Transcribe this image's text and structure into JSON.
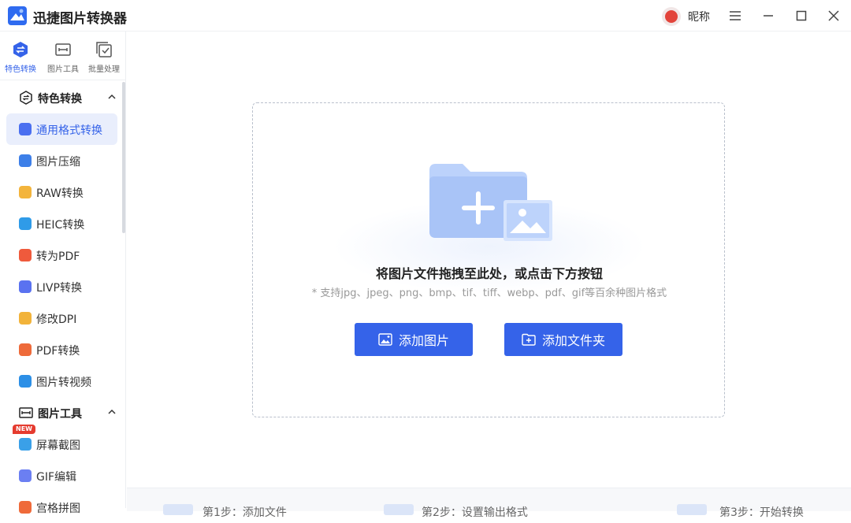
{
  "app": {
    "title": "迅捷图片转换器",
    "nickname": "昵称"
  },
  "colors": {
    "accent": "#3563e9",
    "badge": "#e53b2f"
  },
  "topnav": [
    {
      "label": "特色转换",
      "icon": "feature-convert-icon",
      "active": true
    },
    {
      "label": "图片工具",
      "icon": "image-tools-icon",
      "active": false
    },
    {
      "label": "批量处理",
      "icon": "batch-process-icon",
      "active": false
    }
  ],
  "sidebar": {
    "sections": [
      {
        "label": "特色转换",
        "icon": "feature-convert-icon"
      },
      {
        "label": "图片工具",
        "icon": "image-tools-icon"
      }
    ],
    "items": [
      {
        "label": "通用格式转换",
        "icon": "format-convert-icon",
        "active": true
      },
      {
        "label": "图片压缩",
        "icon": "compress-icon"
      },
      {
        "label": "RAW转换",
        "icon": "raw-icon"
      },
      {
        "label": "HEIC转换",
        "icon": "heic-icon"
      },
      {
        "label": "转为PDF",
        "icon": "pdf-icon"
      },
      {
        "label": "LIVP转换",
        "icon": "livp-icon"
      },
      {
        "label": "修改DPI",
        "icon": "dpi-icon"
      },
      {
        "label": "PDF转换",
        "icon": "pdf-convert-icon"
      },
      {
        "label": "图片转视频",
        "icon": "video-icon"
      },
      {
        "label": "屏幕截图",
        "icon": "screenshot-icon",
        "badge": "NEW"
      },
      {
        "label": "GIF编辑",
        "icon": "gif-icon"
      },
      {
        "label": "宫格拼图",
        "icon": "grid-collage-icon"
      }
    ]
  },
  "dropzone": {
    "headline": "将图片文件拖拽至此处，或点击下方按钮",
    "formats": "* 支持jpg、jpeg、png、bmp、tif、tiff、webp、pdf、gif等百余种图片格式",
    "add_image_label": "添加图片",
    "add_folder_label": "添加文件夹"
  },
  "steps": [
    {
      "label": "第1步：添加文件"
    },
    {
      "label": "第2步：设置输出格式"
    },
    {
      "label": "第3步：开始转换"
    }
  ]
}
